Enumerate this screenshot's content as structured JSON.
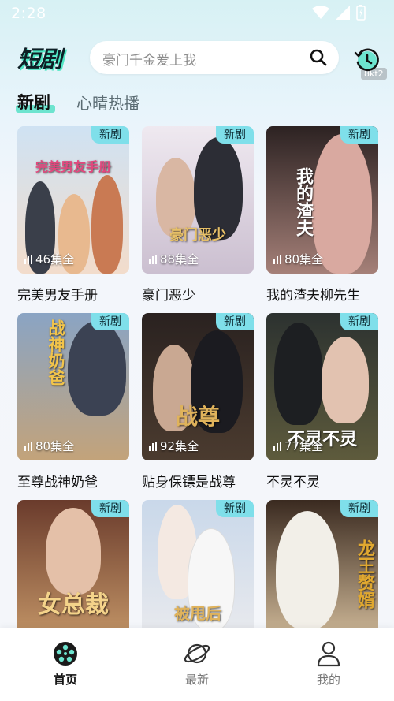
{
  "status_bar": {
    "time": "2:28"
  },
  "header": {
    "logo_text": "短剧",
    "search_placeholder": "豪门千金爱上我",
    "history_badge": "8kt2"
  },
  "tabs": [
    {
      "label": "新剧",
      "active": true
    },
    {
      "label": "心晴热播",
      "active": false
    }
  ],
  "dramas": [
    {
      "title": "完美男友手册",
      "episodes": "46集全",
      "badge": "新剧",
      "poster_text": "完美男友手册",
      "color_top": "#c9def0",
      "color_bottom": "#f0d9c8"
    },
    {
      "title": "豪门恶少",
      "episodes": "88集全",
      "badge": "新剧",
      "poster_text": "豪门恶少",
      "color_top": "#e6e0ea",
      "color_bottom": "#cfc6d6"
    },
    {
      "title": "我的渣夫柳先生",
      "episodes": "80集全",
      "badge": "新剧",
      "poster_text": "我的渣夫",
      "color_top": "#3a2b2b",
      "color_bottom": "#a37a74"
    },
    {
      "title": "至尊战神奶爸",
      "episodes": "80集全",
      "badge": "新剧",
      "poster_text": "战神奶爸",
      "color_top": "#8fa7c2",
      "color_bottom": "#c0a075"
    },
    {
      "title": "贴身保镖是战尊",
      "episodes": "92集全",
      "badge": "新剧",
      "poster_text": "战尊",
      "color_top": "#2b2220",
      "color_bottom": "#4a3a2e"
    },
    {
      "title": "不灵不灵",
      "episodes": "77集全",
      "badge": "新剧",
      "poster_text": "不灵不灵",
      "color_top": "#2f3432",
      "color_bottom": "#5b5a3e"
    },
    {
      "title": "",
      "episodes": "",
      "badge": "新剧",
      "poster_text": "女总裁",
      "color_top": "#6a3b2c",
      "color_bottom": "#c89a6a"
    },
    {
      "title": "",
      "episodes": "",
      "badge": "新剧",
      "poster_text": "被甩后",
      "color_top": "#c5d6e8",
      "color_bottom": "#e9e9ec"
    },
    {
      "title": "",
      "episodes": "",
      "badge": "新剧",
      "poster_text": "龙王赘婿",
      "color_top": "#3a2a20",
      "color_bottom": "#d9c2a0"
    }
  ],
  "bottom_nav": [
    {
      "label": "首页",
      "icon": "film-reel-icon",
      "active": true
    },
    {
      "label": "最新",
      "icon": "planet-icon",
      "active": false
    },
    {
      "label": "我的",
      "icon": "user-icon",
      "active": false
    }
  ],
  "colors": {
    "accent": "#6de4cf",
    "badge": "#7fdfea"
  }
}
